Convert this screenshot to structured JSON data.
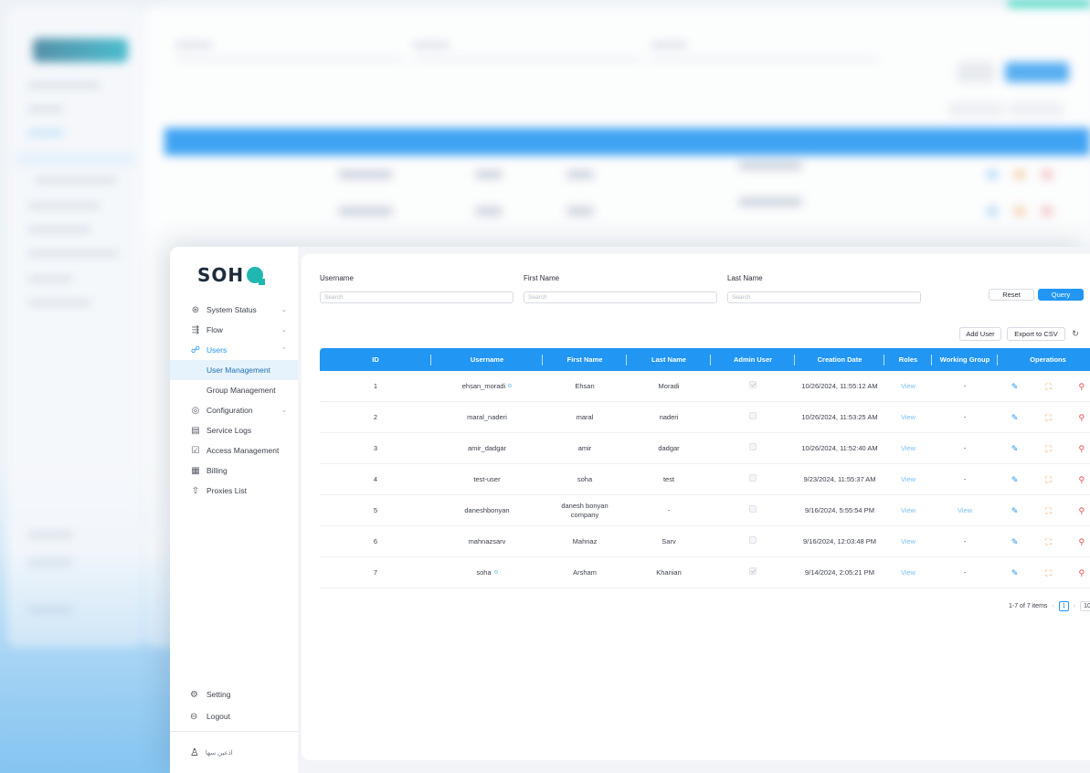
{
  "app": {
    "logo_text": "SOHA",
    "brand_color": "#2196f3",
    "accent_color": "#1fb7b0"
  },
  "sidebar": {
    "items": [
      {
        "label": "System Status",
        "icon": "gauge-icon",
        "expandable": true
      },
      {
        "label": "Flow",
        "icon": "flow-icon",
        "expandable": true
      },
      {
        "label": "Users",
        "icon": "users-icon",
        "expandable": true,
        "expanded": true
      },
      {
        "label": "Configuration",
        "icon": "config-icon",
        "expandable": true
      },
      {
        "label": "Service Logs",
        "icon": "logs-icon"
      },
      {
        "label": "Access Management",
        "icon": "access-icon"
      },
      {
        "label": "Billing",
        "icon": "billing-icon"
      },
      {
        "label": "Proxies List",
        "icon": "proxy-icon"
      }
    ],
    "users_submenu": [
      {
        "label": "User Management",
        "selected": true
      },
      {
        "label": "Group Management"
      }
    ],
    "bottom": [
      {
        "label": "Setting",
        "icon": "gear-icon"
      },
      {
        "label": "Logout",
        "icon": "logout-icon"
      }
    ],
    "user_name": "اذعین سها"
  },
  "filters": {
    "username_label": "Username",
    "firstname_label": "First Name",
    "lastname_label": "Last Name",
    "placeholder": "Search",
    "reset_label": "Reset",
    "query_label": "Query"
  },
  "actions": {
    "add_user": "Add User",
    "export_csv": "Export to CSV"
  },
  "table": {
    "columns": [
      "ID",
      "Username",
      "First Name",
      "Last Name",
      "Admin User",
      "Creation Date",
      "Roles",
      "Working Group",
      "Operations"
    ],
    "rows": [
      {
        "id": "1",
        "username": "ehsan_moradi",
        "online": true,
        "first": "Ehsan",
        "last": "Moradi",
        "admin": true,
        "date": "10/26/2024, 11:55:12 AM",
        "roles": "View",
        "group": "-"
      },
      {
        "id": "2",
        "username": "maral_naderi",
        "online": false,
        "first": "maral",
        "last": "naderi",
        "admin": false,
        "date": "10/26/2024, 11:53:25 AM",
        "roles": "View",
        "group": "-"
      },
      {
        "id": "3",
        "username": "amir_dadgar",
        "online": false,
        "first": "amir",
        "last": "dadgar",
        "admin": false,
        "date": "10/26/2024, 11:52:40 AM",
        "roles": "View",
        "group": "-"
      },
      {
        "id": "4",
        "username": "test-user",
        "online": false,
        "first": "soha",
        "last": "test",
        "admin": false,
        "date": "9/23/2024, 11:55:37 AM",
        "roles": "View",
        "group": "-"
      },
      {
        "id": "5",
        "username": "daneshbonyan",
        "online": false,
        "first": "danesh bonyan company",
        "last": "-",
        "admin": false,
        "date": "9/16/2024, 5:55:54 PM",
        "roles": "View",
        "group": "View"
      },
      {
        "id": "6",
        "username": "mahnazsarv",
        "online": false,
        "first": "Mahnaz",
        "last": "Sarv",
        "admin": false,
        "date": "9/16/2024, 12:03:48 PM",
        "roles": "View",
        "group": "-"
      },
      {
        "id": "7",
        "username": "soha",
        "online": true,
        "first": "Arsham",
        "last": "Khanian",
        "admin": true,
        "date": "9/14/2024, 2:05:21 PM",
        "roles": "View",
        "group": "-"
      }
    ]
  },
  "pagination": {
    "summary": "1-7 of 7 items",
    "current_page": "1",
    "page_size": "10"
  }
}
